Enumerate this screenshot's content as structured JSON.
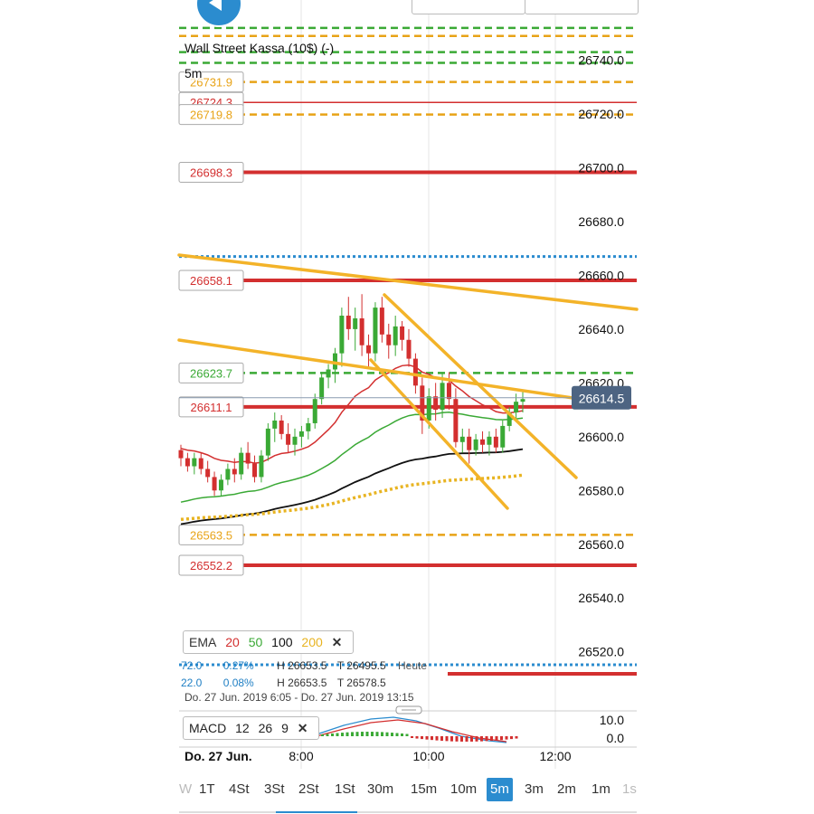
{
  "header": {
    "instrument_title": "Wall Street Kassa (10$) (-)",
    "interval": "5m"
  },
  "chart_data": [
    {
      "type": "candlestick",
      "price_axis": {
        "ticks": [
          "26740.0",
          "26720.0",
          "26700.0",
          "26680.0",
          "26660.0",
          "26640.0",
          "26620.0",
          "26600.0",
          "26580.0",
          "26560.0",
          "26540.0",
          "26520.0"
        ],
        "range": [
          26510,
          26750
        ]
      },
      "time_axis": {
        "date_label": "Do. 27 Jun.",
        "ticks": [
          "8:00",
          "10:00",
          "12:00"
        ]
      },
      "current_price": "26614.5",
      "level_labels": [
        {
          "value": "26731.9",
          "color": "#e8a317",
          "style": "dashed"
        },
        {
          "value": "26724.3",
          "color": "#d32f2f",
          "style": "solid"
        },
        {
          "value": "26719.8",
          "color": "#e8a317",
          "style": "dashed"
        },
        {
          "value": "26698.3",
          "color": "#d32f2f",
          "style": "solid"
        },
        {
          "value": "26658.1",
          "color": "#d32f2f",
          "style": "solid"
        },
        {
          "value": "26623.7",
          "color": "#3aa935",
          "style": "dashed"
        },
        {
          "value": "26611.1",
          "color": "#d32f2f",
          "style": "solid"
        },
        {
          "value": "26563.5",
          "color": "#e8a317",
          "style": "dashed"
        },
        {
          "value": "26552.2",
          "color": "#d32f2f",
          "style": "solid"
        }
      ],
      "candles": [
        {
          "o": 26595,
          "h": 26597,
          "l": 26589,
          "c": 26592
        },
        {
          "o": 26592,
          "h": 26594,
          "l": 26587,
          "c": 26589
        },
        {
          "o": 26589,
          "h": 26594,
          "l": 26586,
          "c": 26592
        },
        {
          "o": 26592,
          "h": 26594,
          "l": 26586,
          "c": 26588
        },
        {
          "o": 26588,
          "h": 26591,
          "l": 26583,
          "c": 26585
        },
        {
          "o": 26585,
          "h": 26587,
          "l": 26578,
          "c": 26580
        },
        {
          "o": 26580,
          "h": 26586,
          "l": 26578,
          "c": 26584
        },
        {
          "o": 26584,
          "h": 26590,
          "l": 26582,
          "c": 26588
        },
        {
          "o": 26588,
          "h": 26592,
          "l": 26583,
          "c": 26586
        },
        {
          "o": 26586,
          "h": 26596,
          "l": 26584,
          "c": 26594
        },
        {
          "o": 26594,
          "h": 26598,
          "l": 26588,
          "c": 26590
        },
        {
          "o": 26590,
          "h": 26593,
          "l": 26583,
          "c": 26585
        },
        {
          "o": 26585,
          "h": 26595,
          "l": 26583,
          "c": 26593
        },
        {
          "o": 26593,
          "h": 26605,
          "l": 26591,
          "c": 26603
        },
        {
          "o": 26603,
          "h": 26609,
          "l": 26598,
          "c": 26606
        },
        {
          "o": 26606,
          "h": 26608,
          "l": 26599,
          "c": 26601
        },
        {
          "o": 26601,
          "h": 26605,
          "l": 26594,
          "c": 26597
        },
        {
          "o": 26597,
          "h": 26603,
          "l": 26593,
          "c": 26600
        },
        {
          "o": 26600,
          "h": 26604,
          "l": 26596,
          "c": 26602
        },
        {
          "o": 26602,
          "h": 26607,
          "l": 26599,
          "c": 26605
        },
        {
          "o": 26605,
          "h": 26616,
          "l": 26603,
          "c": 26614
        },
        {
          "o": 26614,
          "h": 26624,
          "l": 26612,
          "c": 26622
        },
        {
          "o": 26622,
          "h": 26627,
          "l": 26618,
          "c": 26625
        },
        {
          "o": 26625,
          "h": 26633,
          "l": 26620,
          "c": 26631
        },
        {
          "o": 26631,
          "h": 26648,
          "l": 26626,
          "c": 26645
        },
        {
          "o": 26645,
          "h": 26652,
          "l": 26636,
          "c": 26640
        },
        {
          "o": 26640,
          "h": 26648,
          "l": 26632,
          "c": 26644
        },
        {
          "o": 26644,
          "h": 26653,
          "l": 26630,
          "c": 26634
        },
        {
          "o": 26634,
          "h": 26638,
          "l": 26626,
          "c": 26631
        },
        {
          "o": 26631,
          "h": 26650,
          "l": 26628,
          "c": 26648
        },
        {
          "o": 26648,
          "h": 26652,
          "l": 26635,
          "c": 26638
        },
        {
          "o": 26638,
          "h": 26642,
          "l": 26629,
          "c": 26634
        },
        {
          "o": 26634,
          "h": 26645,
          "l": 26630,
          "c": 26641
        },
        {
          "o": 26641,
          "h": 26643,
          "l": 26632,
          "c": 26636
        },
        {
          "o": 26636,
          "h": 26640,
          "l": 26626,
          "c": 26629
        },
        {
          "o": 26629,
          "h": 26631,
          "l": 26616,
          "c": 26619
        },
        {
          "o": 26619,
          "h": 26622,
          "l": 26601,
          "c": 26606
        },
        {
          "o": 26606,
          "h": 26618,
          "l": 26603,
          "c": 26615
        },
        {
          "o": 26615,
          "h": 26620,
          "l": 26606,
          "c": 26610
        },
        {
          "o": 26610,
          "h": 26624,
          "l": 26607,
          "c": 26620
        },
        {
          "o": 26620,
          "h": 26624,
          "l": 26610,
          "c": 26614
        },
        {
          "o": 26614,
          "h": 26618,
          "l": 26596,
          "c": 26598
        },
        {
          "o": 26598,
          "h": 26603,
          "l": 26594,
          "c": 26600
        },
        {
          "o": 26600,
          "h": 26603,
          "l": 26590,
          "c": 26595
        },
        {
          "o": 26595,
          "h": 26601,
          "l": 26593,
          "c": 26599
        },
        {
          "o": 26599,
          "h": 26602,
          "l": 26594,
          "c": 26597
        },
        {
          "o": 26597,
          "h": 26602,
          "l": 26593,
          "c": 26600
        },
        {
          "o": 26600,
          "h": 26603,
          "l": 26594,
          "c": 26596
        },
        {
          "o": 26596,
          "h": 26606,
          "l": 26594,
          "c": 26604
        },
        {
          "o": 26604,
          "h": 26611,
          "l": 26602,
          "c": 26609
        },
        {
          "o": 26609,
          "h": 26616,
          "l": 26606,
          "c": 26613
        },
        {
          "o": 26613,
          "h": 26617,
          "l": 26609,
          "c": 26614
        }
      ],
      "ema_legend": {
        "label": "EMA",
        "periods": [
          {
            "period": "20",
            "color": "#d32f2f"
          },
          {
            "period": "50",
            "color": "#3aa935"
          },
          {
            "period": "100",
            "color": "#111111"
          },
          {
            "period": "200",
            "color": "#e8b422"
          }
        ]
      },
      "grid": false
    },
    {
      "type": "macd",
      "legend": {
        "label": "MACD",
        "params": [
          "12",
          "26",
          "9"
        ]
      },
      "axis_ticks": [
        "10.0",
        "0.0"
      ]
    }
  ],
  "info": {
    "row1": {
      "a": "72.0",
      "b": "0.27%",
      "h": "H 26653.5",
      "t": "T 26495.5",
      "label": "Heute"
    },
    "row2": {
      "a": "22.0",
      "b": "0.08%",
      "h": "H 26653.5",
      "t": "T 26578.5"
    },
    "range": "Do. 27 Jun. 2019 6:05 - Do. 27 Jun. 2019 13:15"
  },
  "timeframes": [
    {
      "label": "W",
      "faded": true
    },
    {
      "label": "1T"
    },
    {
      "label": "4St"
    },
    {
      "label": "3St"
    },
    {
      "label": "2St"
    },
    {
      "label": "1St"
    },
    {
      "label": "30m"
    },
    {
      "label": "15m"
    },
    {
      "label": "10m"
    },
    {
      "label": "5m",
      "active": true
    },
    {
      "label": "3m"
    },
    {
      "label": "2m"
    },
    {
      "label": "1m"
    },
    {
      "label": "1s",
      "faded": true
    }
  ]
}
